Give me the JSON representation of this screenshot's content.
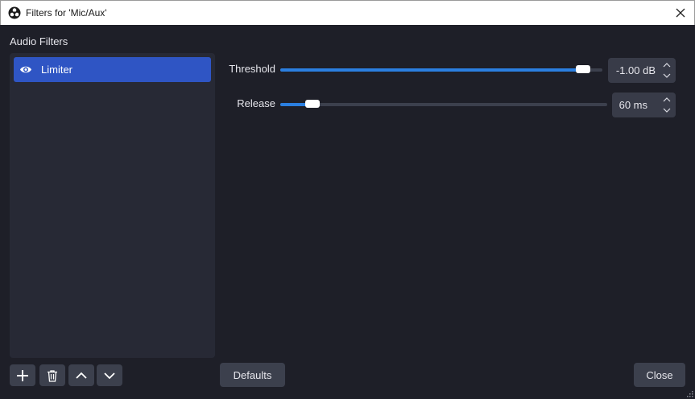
{
  "window": {
    "title": "Filters for 'Mic/Aux'"
  },
  "filters": {
    "section_label": "Audio Filters",
    "items": [
      {
        "name": "Limiter",
        "visible": true
      }
    ]
  },
  "properties": {
    "threshold": {
      "label": "Threshold",
      "value": "-1.00 dB",
      "level": 0.96
    },
    "release": {
      "label": "Release",
      "value": "60 ms",
      "level": 0.08
    }
  },
  "buttons": {
    "defaults": "Defaults",
    "close": "Close"
  },
  "colors": {
    "accent": "#2f55c4",
    "slider_fill": "#2b7fe0",
    "background": "#1e1f28",
    "panel": "#272935"
  }
}
